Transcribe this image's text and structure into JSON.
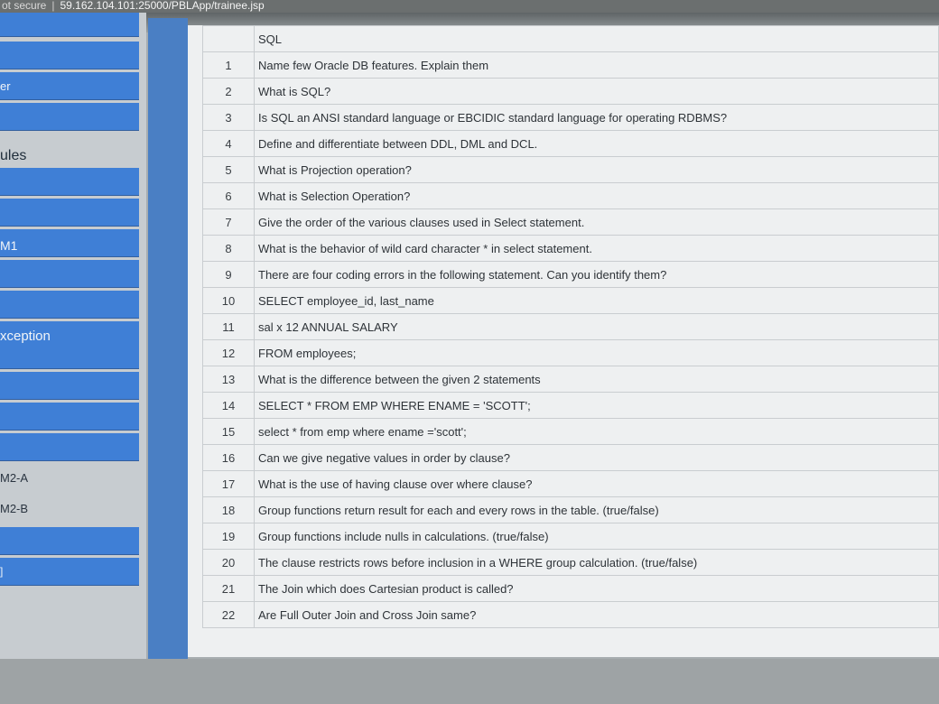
{
  "address_bar": {
    "security_text": "ot secure",
    "separator": "|",
    "url": "59.162.104.101:25000/PBLApp/trainee.jsp"
  },
  "sidebar": {
    "labels": {
      "item_er": "er",
      "item_ules": "ules",
      "item_m1": "M1",
      "item_xception": "xception",
      "item_m2a": "M2-A",
      "item_m2b": "M2-B",
      "item_bracket": "]"
    }
  },
  "table": {
    "header": "SQL",
    "rows": [
      {
        "num": "1",
        "text": "Name few Oracle DB features. Explain them"
      },
      {
        "num": "2",
        "text": "What is SQL?"
      },
      {
        "num": "3",
        "text": "Is SQL an ANSI standard language or EBCIDIC standard language for operating RDBMS?"
      },
      {
        "num": "4",
        "text": "Define and differentiate between DDL, DML and DCL."
      },
      {
        "num": "5",
        "text": "What is Projection operation?"
      },
      {
        "num": "6",
        "text": "What is Selection Operation?"
      },
      {
        "num": "7",
        "text": "Give the order of the various clauses used in Select statement."
      },
      {
        "num": "8",
        "text": "What is the behavior of wild card character * in select statement."
      },
      {
        "num": "9",
        "text": "There are four coding errors in the following statement. Can you identify them?"
      },
      {
        "num": "10",
        "text": "SELECT employee_id, last_name"
      },
      {
        "num": "11",
        "text": "sal x 12 ANNUAL SALARY"
      },
      {
        "num": "12",
        "text": "FROM employees;"
      },
      {
        "num": "13",
        "text": "What is the difference between the given 2 statements"
      },
      {
        "num": "14",
        "text": "SELECT * FROM EMP WHERE ENAME = 'SCOTT';"
      },
      {
        "num": "15",
        "text": "select * from emp where ename ='scott';"
      },
      {
        "num": "16",
        "text": "Can we give negative values in order by clause?"
      },
      {
        "num": "17",
        "text": "What is the use of having clause over where clause?"
      },
      {
        "num": "18",
        "text": "Group functions return result for each and every rows in the table. (true/false)"
      },
      {
        "num": "19",
        "text": "Group functions include nulls in calculations. (true/false)"
      },
      {
        "num": "20",
        "text": "The clause restricts rows before inclusion in a WHERE group calculation. (true/false)"
      },
      {
        "num": "21",
        "text": "The Join which does Cartesian product is called?"
      },
      {
        "num": "22",
        "text": "Are Full Outer Join and Cross Join same?"
      }
    ]
  },
  "colors": {
    "sidebar_blue": "#3f7fd6",
    "table_bg": "#eef0f1",
    "divider_blue": "#4a7fc4"
  }
}
